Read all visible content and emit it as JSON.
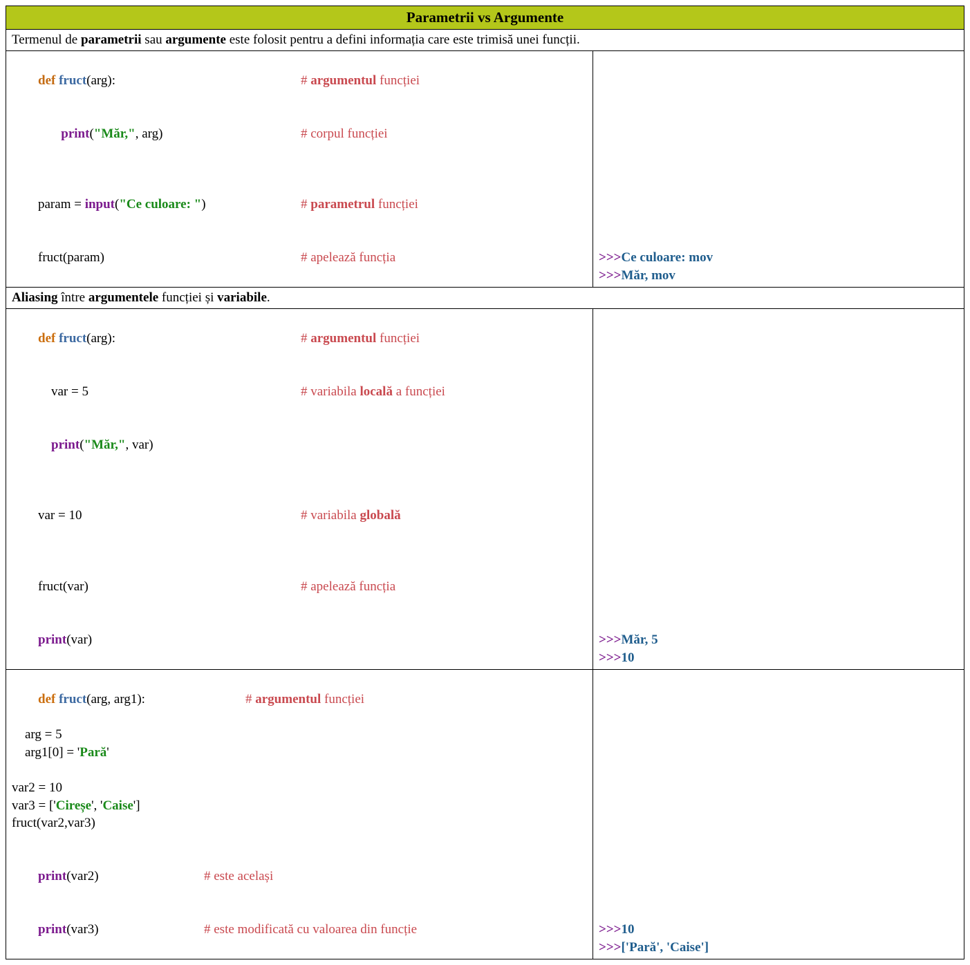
{
  "header_title": "Parametrii vs Argumente",
  "intro": {
    "pre": "Termenul de ",
    "b1": "parametrii",
    "mid1": " sau ",
    "b2": "argumente",
    "post": " este folosit pentru a defini informația care este trimisă unei funcții."
  },
  "ex1": {
    "l1c": "def ",
    "l1fn": "fruct",
    "l1post": "(arg):",
    "l1cmtpre": "# ",
    "l1cmtb": "argumentul",
    "l1cmtpost": " funcției",
    "l2pre": "       ",
    "l2fn": "print",
    "l2a": "(",
    "l2s": "\"Măr,\"",
    "l2b": ", arg)",
    "l2cmt": "# corpul funcției",
    "blank": " ",
    "l3a": "param = ",
    "l3fn": "input",
    "l3b": "(",
    "l3s": "\"Ce culoare: \"",
    "l3c": ")",
    "l3cmtpre": "# ",
    "l3cmtb": "parametrul",
    "l3cmtpost": " funcției",
    "l4": "fruct(param)",
    "l4cmt": "# apelează funcția",
    "out1p": ">>>",
    "out1": "Ce culoare: mov",
    "out2p": ">>>",
    "out2": "Măr, mov"
  },
  "aliasing": {
    "b1": "Aliasing",
    "t1": " între ",
    "b2": "argumentele",
    "t2": " funcției și ",
    "b3": "variabile",
    "t3": "."
  },
  "ex2": {
    "l1c": "def ",
    "l1fn": "fruct",
    "l1post": "(arg):",
    "l1cmtpre": "# ",
    "l1cmtb": "argumentul",
    "l1cmtpost": " funcției",
    "l2pre": "    ",
    "l2": "var = 5",
    "l2cmtpre": "# variabila ",
    "l2cmtb": "locală",
    "l2cmtpost": " a funcției",
    "l3pre": "    ",
    "l3fn": "print",
    "l3a": "(",
    "l3s": "\"Măr,\"",
    "l3b": ", var)",
    "blank": " ",
    "l4": "var = 10",
    "l4cmtpre": "# variabila ",
    "l4cmtb": "globală",
    "l5": "fruct(var)",
    "l5cmt": "# apelează funcția",
    "l6fn": "print",
    "l6a": "(var)",
    "out1p": ">>>",
    "out1": "Măr, 5",
    "out2p": ">>>",
    "out2": "10"
  },
  "ex3": {
    "l1c": "def ",
    "l1fn": "fruct",
    "l1post": "(arg, arg1):",
    "l1cmtpre": "# ",
    "l1cmtb": "argumentul",
    "l1cmtpost": " funcției",
    "l2": "    arg = 5",
    "l3a": "    arg1[0] = '",
    "l3s": "Pară",
    "l3b": "'",
    "blank": " ",
    "l4": "var2 = 10",
    "l5a": "var3 = ['",
    "l5s1": "Cireșe",
    "l5b": "', '",
    "l5s2": "Caise",
    "l5c": "']",
    "l6": "fruct(var2,var3)",
    "l7fn": "print",
    "l7a": "(var2)",
    "l7cmt": "# este același",
    "l8fn": "print",
    "l8a": "(var3)",
    "l8cmt": "# este modificată cu valoarea din funcție",
    "out1p": ">>>",
    "out1": "10",
    "out2p": ">>>",
    "out2": "['Pară', 'Caise']"
  }
}
